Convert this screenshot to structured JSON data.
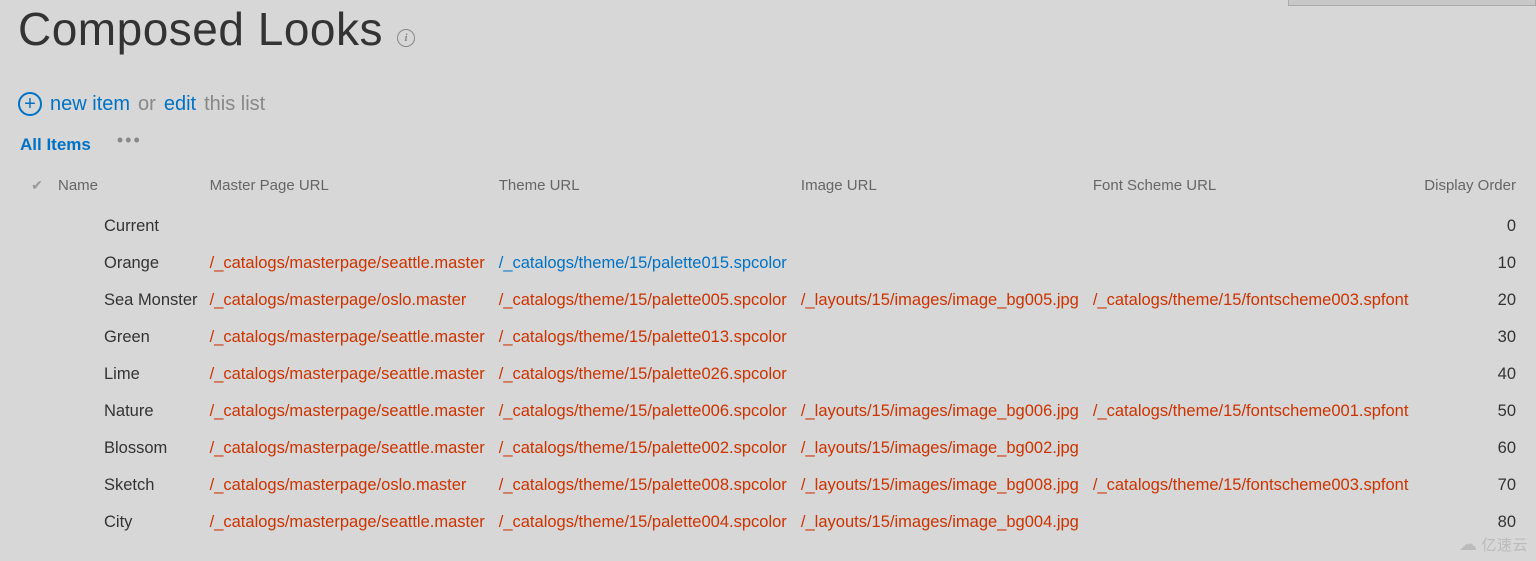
{
  "page_title": "Composed Looks",
  "action_bar": {
    "new_item": "new item",
    "or": "or",
    "edit": "edit",
    "this_list": "this list"
  },
  "view": {
    "current": "All Items"
  },
  "columns": {
    "name": "Name",
    "master": "Master Page URL",
    "theme": "Theme URL",
    "image": "Image URL",
    "font": "Font Scheme URL",
    "order": "Display Order"
  },
  "rows": [
    {
      "name": "Current",
      "master": "",
      "theme": "",
      "image": "",
      "font": "",
      "order": "0",
      "visited": true
    },
    {
      "name": "Orange",
      "master": "/_catalogs/masterpage/seattle.master",
      "theme": "/_catalogs/theme/15/palette015.spcolor",
      "image": "",
      "font": "",
      "order": "10",
      "visited": false
    },
    {
      "name": "Sea Monster",
      "master": "/_catalogs/masterpage/oslo.master",
      "theme": "/_catalogs/theme/15/palette005.spcolor",
      "image": "/_layouts/15/images/image_bg005.jpg",
      "font": "/_catalogs/theme/15/fontscheme003.spfont",
      "order": "20",
      "visited": true
    },
    {
      "name": "Green",
      "master": "/_catalogs/masterpage/seattle.master",
      "theme": "/_catalogs/theme/15/palette013.spcolor",
      "image": "",
      "font": "",
      "order": "30",
      "visited": true
    },
    {
      "name": "Lime",
      "master": "/_catalogs/masterpage/seattle.master",
      "theme": "/_catalogs/theme/15/palette026.spcolor",
      "image": "",
      "font": "",
      "order": "40",
      "visited": true
    },
    {
      "name": "Nature",
      "master": "/_catalogs/masterpage/seattle.master",
      "theme": "/_catalogs/theme/15/palette006.spcolor",
      "image": "/_layouts/15/images/image_bg006.jpg",
      "font": "/_catalogs/theme/15/fontscheme001.spfont",
      "order": "50",
      "visited": true
    },
    {
      "name": "Blossom",
      "master": "/_catalogs/masterpage/seattle.master",
      "theme": "/_catalogs/theme/15/palette002.spcolor",
      "image": "/_layouts/15/images/image_bg002.jpg",
      "font": "",
      "order": "60",
      "visited": true
    },
    {
      "name": "Sketch",
      "master": "/_catalogs/masterpage/oslo.master",
      "theme": "/_catalogs/theme/15/palette008.spcolor",
      "image": "/_layouts/15/images/image_bg008.jpg",
      "font": "/_catalogs/theme/15/fontscheme003.spfont",
      "order": "70",
      "visited": true
    },
    {
      "name": "City",
      "master": "/_catalogs/masterpage/seattle.master",
      "theme": "/_catalogs/theme/15/palette004.spcolor",
      "image": "/_layouts/15/images/image_bg004.jpg",
      "font": "",
      "order": "80",
      "visited": true
    }
  ],
  "watermark": "亿速云"
}
